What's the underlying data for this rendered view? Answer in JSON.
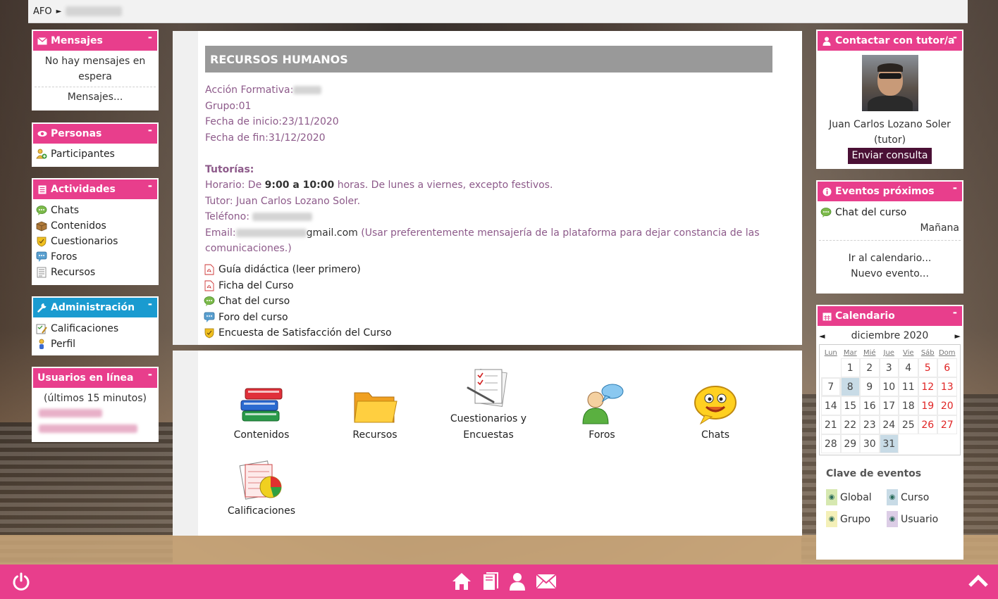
{
  "breadcrumb": {
    "home": "AFO",
    "separator": "►"
  },
  "blocks": {
    "mensajes": {
      "title": "Mensajes",
      "collapse": "-",
      "empty_text": "No hay mensajes en espera",
      "link": "Mensajes..."
    },
    "personas": {
      "title": "Personas",
      "collapse": "-",
      "items": [
        "Participantes"
      ]
    },
    "actividades": {
      "title": "Actividades",
      "collapse": "-",
      "items": [
        "Chats",
        "Contenidos",
        "Cuestionarios",
        "Foros",
        "Recursos"
      ]
    },
    "administracion": {
      "title": "Administración",
      "collapse": "-",
      "items": [
        "Calificaciones",
        "Perfil"
      ]
    },
    "usuarios": {
      "title": "Usuarios en línea",
      "collapse": "-",
      "subtitle": "(últimos 15 minutos)"
    },
    "tutor": {
      "title": "Contactar con tutor/a",
      "collapse": "-",
      "name": "Juan Carlos Lozano Soler",
      "role": "(tutor)",
      "button": "Enviar consulta"
    },
    "eventos": {
      "title": "Eventos próximos",
      "collapse": "-",
      "event": "Chat del curso",
      "when": "Mañana",
      "link_calendar": "Ir al calendario...",
      "link_new": "Nuevo evento..."
    },
    "calendario": {
      "title": "Calendario",
      "collapse": "-",
      "month": "diciembre 2020",
      "prev": "◄",
      "next": "►",
      "weekdays": [
        "Lun",
        "Mar",
        "Mié",
        "Jue",
        "Vie",
        "Sáb",
        "Dom"
      ],
      "weeks": [
        [
          "",
          "1",
          "2",
          "3",
          "4",
          "5",
          "6"
        ],
        [
          "7",
          "8",
          "9",
          "10",
          "11",
          "12",
          "13"
        ],
        [
          "14",
          "15",
          "16",
          "17",
          "18",
          "19",
          "20"
        ],
        [
          "21",
          "22",
          "23",
          "24",
          "25",
          "26",
          "27"
        ],
        [
          "28",
          "29",
          "30",
          "31",
          "",
          "",
          ""
        ]
      ],
      "legend_title": "Clave de eventos",
      "legend": [
        "Global",
        "Curso",
        "Grupo",
        "Usuario"
      ]
    }
  },
  "course": {
    "title": "RECURSOS HUMANOS",
    "accion_label": "Acción Formativa:",
    "grupo": "Grupo:01",
    "inicio": "Fecha de inicio:23/11/2020",
    "fin": "Fecha de fin:31/12/2020",
    "tutorias_label": "Tutorías:",
    "horario_pre": "Horario: De ",
    "horario_bold": "9:00 a 10:00",
    "horario_post": " horas. De lunes a viernes, excepto festivos.",
    "tutor_line": "Tutor: Juan Carlos Lozano Soler.",
    "telefono_label": "Teléfono:",
    "email_label": "Email:",
    "email_domain": "gmail.com",
    "email_note": " (Usar preferentemente mensajería de la plataforma para dejar constancia de las comunicaciones.)",
    "links": [
      "Guía didáctica (leer primero)",
      "Ficha del Curso",
      "Chat del curso",
      "Foro del curso",
      "Encuesta de Satisfacción del Curso"
    ]
  },
  "tiles": [
    "Contenidos",
    "Recursos",
    "Cuestionarios y Encuestas",
    "Foros",
    "Chats",
    "Calificaciones"
  ],
  "colors": {
    "accent": "#e83e8c",
    "admin": "#1a9bd0",
    "info_text": "#8d5a8a",
    "button_dark": "#4a1035",
    "weekend": "#e02424"
  }
}
